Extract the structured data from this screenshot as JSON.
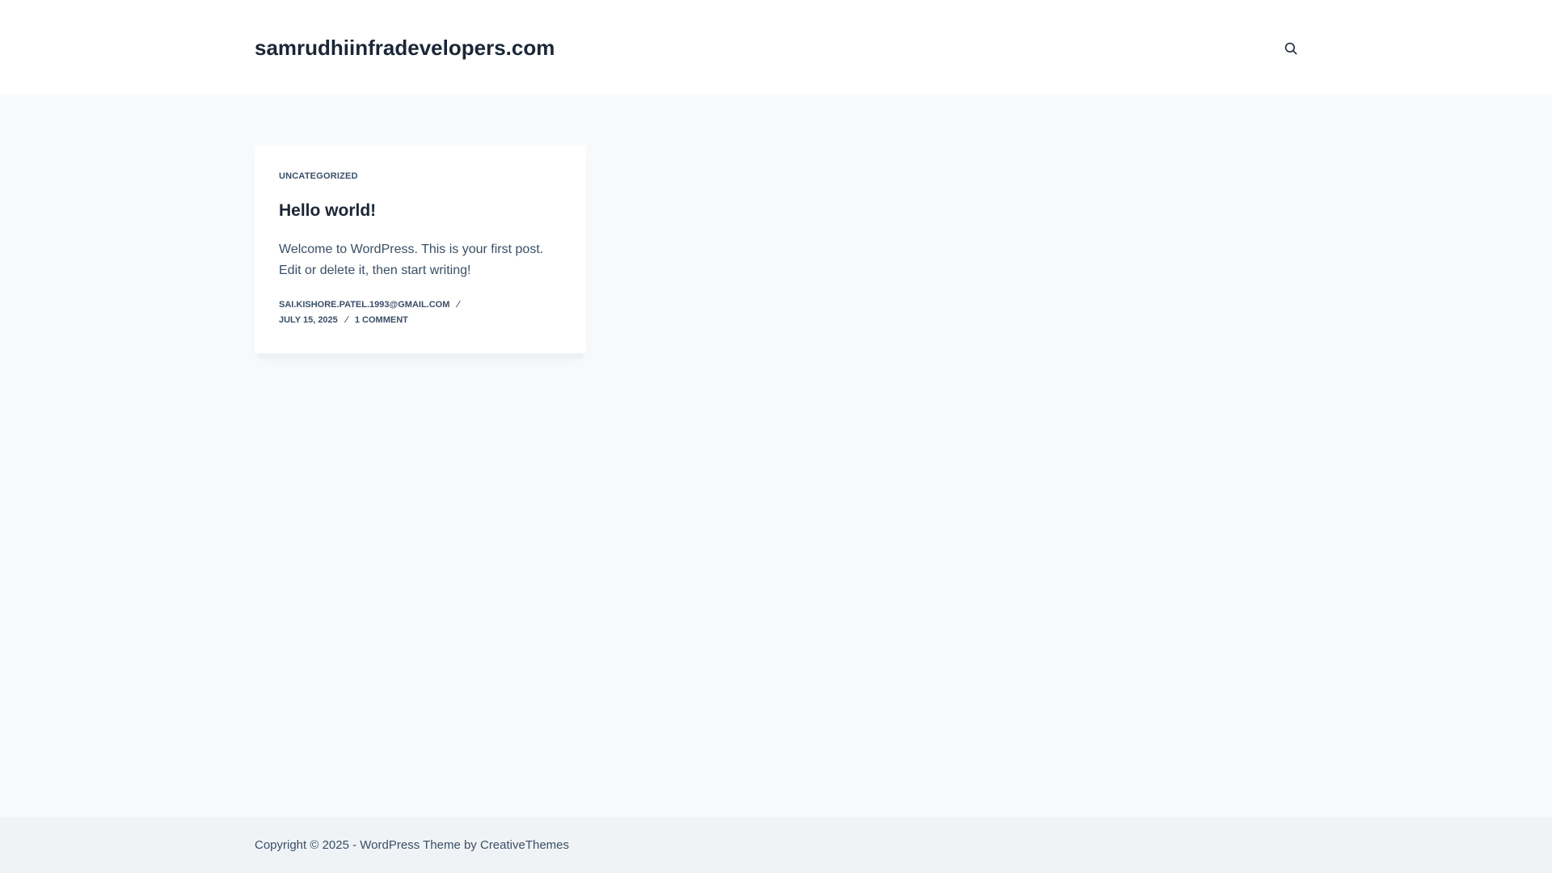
{
  "header": {
    "site_title": "samrudhiinfradevelopers.com",
    "search_icon": "search-icon"
  },
  "post": {
    "category": "UNCATEGORIZED",
    "title": "Hello world!",
    "excerpt": "Welcome to WordPress. This is your first post. Edit or delete it, then start writing!",
    "author": "SAI.KISHORE.PATEL.1993@GMAIL.COM",
    "date": "JULY 15, 2025",
    "comments": "1 COMMENT",
    "separator": "/"
  },
  "footer": {
    "copyright_prefix": "Copyright © 2025 - ",
    "wordpress_theme_link": "WordPress Theme",
    "by_text": " by ",
    "creativethemes_link": "CreativeThemes"
  },
  "colors": {
    "page_background": "#f8f9fb",
    "header_background": "#ffffff",
    "footer_background": "#f0f3f6",
    "heading_text": "#1b2636",
    "body_text": "#3a4f66"
  }
}
